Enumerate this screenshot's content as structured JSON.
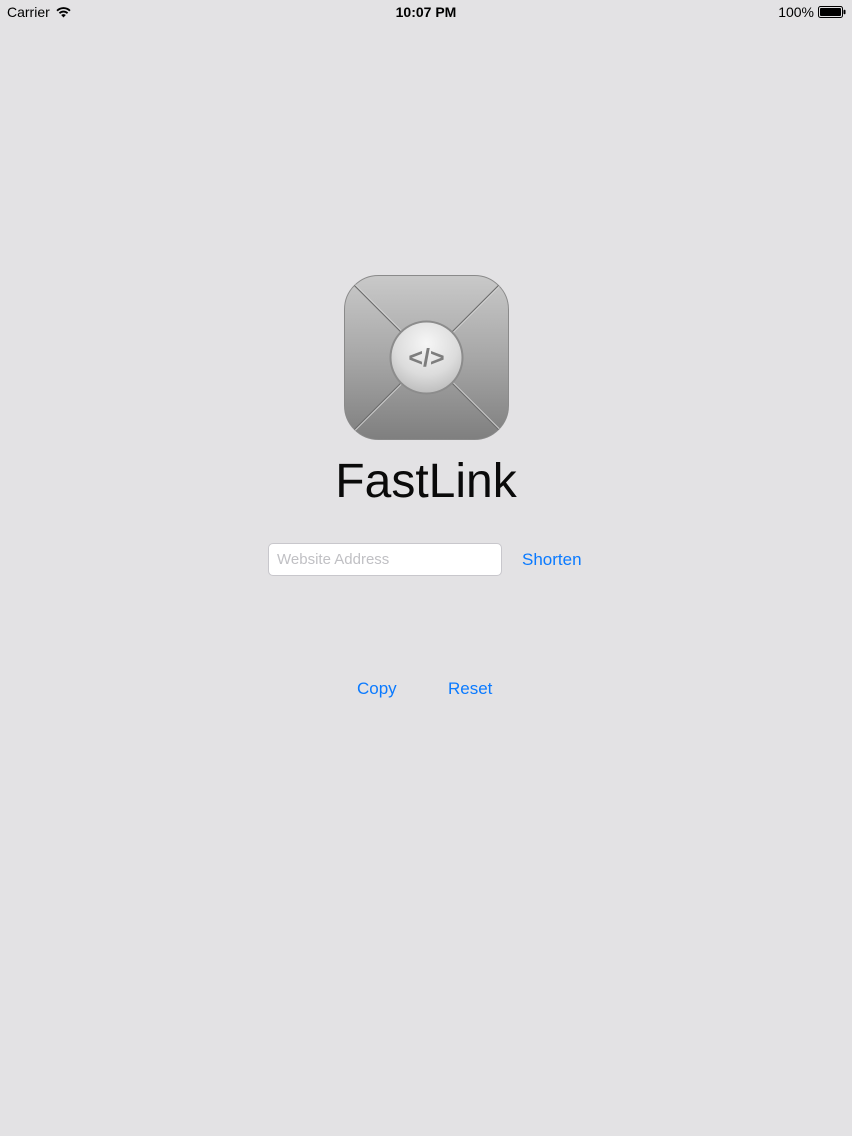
{
  "status_bar": {
    "carrier": "Carrier",
    "time": "10:07 PM",
    "battery_percent": "100%",
    "wifi_icon": "wifi-icon",
    "battery_icon": "battery-full-icon"
  },
  "app": {
    "icon": "code-brackets-icon",
    "icon_glyph": "</>",
    "title": "FastLink"
  },
  "form": {
    "url_placeholder": "Website Address",
    "url_value": "",
    "shorten_label": "Shorten"
  },
  "actions": {
    "copy_label": "Copy",
    "reset_label": "Reset"
  },
  "colors": {
    "background": "#e3e2e4",
    "accent": "#0a7aff"
  }
}
